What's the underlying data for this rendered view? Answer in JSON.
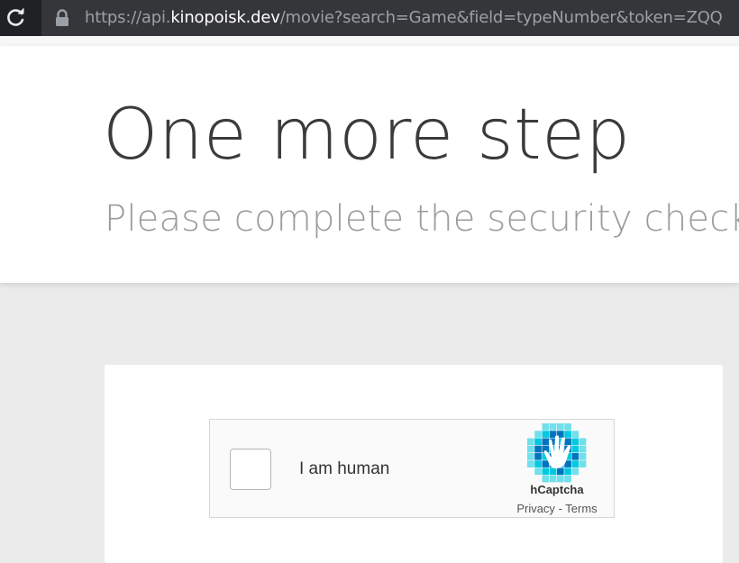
{
  "browser": {
    "url_prefix": "https://api.",
    "url_domain": "kinopoisk.dev",
    "url_rest": "/movie?search=Game&field=typeNumber&token=ZQQ"
  },
  "header": {
    "title": "One more step",
    "subtitle": "Please complete the security check to"
  },
  "captcha": {
    "label": "I am human",
    "brand": "hCaptcha",
    "privacy_label": "Privacy",
    "separator": "-",
    "terms_label": "Terms",
    "checked": false
  },
  "colors": {
    "brand_primary": "#0074bf",
    "brand_secondary": "#00c9e0",
    "page_background": "#ebebeb",
    "address_bar": "#35363a"
  },
  "icons": {
    "reload": "reload-icon",
    "lock": "lock-icon",
    "hcaptcha": "hcaptcha-logo-icon"
  }
}
